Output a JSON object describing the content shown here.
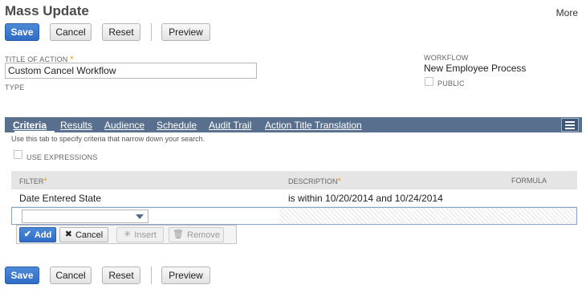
{
  "page": {
    "title": "Mass Update",
    "more_label": "More"
  },
  "toolbar": {
    "save": "Save",
    "cancel": "Cancel",
    "reset": "Reset",
    "preview": "Preview"
  },
  "form": {
    "title_label": "TITLE OF ACTION",
    "title_required": "*",
    "title_value": "Custom Cancel Workflow",
    "type_label": "TYPE",
    "workflow_label": "WORKFLOW",
    "workflow_value": "New Employee Process",
    "public_label": "PUBLIC"
  },
  "tabs": [
    "Criteria",
    "Results",
    "Audience",
    "Schedule",
    "Audit Trail",
    "Action Title Translation"
  ],
  "criteria": {
    "hint": "Use this tab to specify criteria that narrow down your search.",
    "use_expressions_label": "USE EXPRESSIONS",
    "columns": {
      "filter": "FILTER",
      "filter_req": "*",
      "description": "DESCRIPTION",
      "description_req": "*",
      "formula": "FORMULA"
    },
    "rows": [
      {
        "filter": "Date Entered State",
        "description": "is within 10/20/2014 and 10/24/2014",
        "formula": ""
      }
    ],
    "row_buttons": {
      "add": "Add",
      "cancel": "Cancel",
      "insert": "Insert",
      "remove": "Remove"
    }
  },
  "icons": {
    "add": "check-icon",
    "cancel": "x-icon",
    "insert": "insert-icon",
    "remove": "trash-icon",
    "menu": "hamburger-icon",
    "dropdown": "chevron-down-icon"
  },
  "colors": {
    "primary": "#2f6cc6",
    "tabbar": "#58708e",
    "required": "#e8a200"
  }
}
